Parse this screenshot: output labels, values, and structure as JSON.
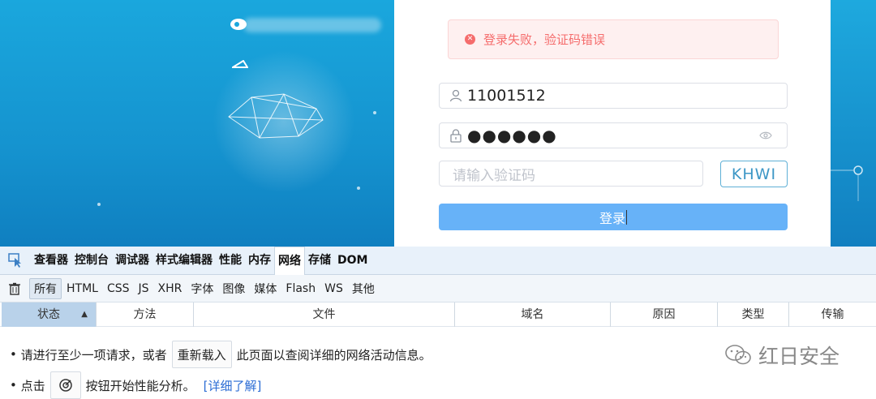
{
  "login": {
    "error_message": "登录失败，验证码错误",
    "username_value": "11001512",
    "password_mask": "●●●●●●",
    "captcha_placeholder": "请输入验证码",
    "captcha_code": "KHWI",
    "login_label": "登录"
  },
  "devtools": {
    "tabs": [
      "查看器",
      "控制台",
      "调试器",
      "样式编辑器",
      "性能",
      "内存",
      "网络",
      "存储",
      "DOM"
    ],
    "active_tab": "网络",
    "filters": [
      "所有",
      "HTML",
      "CSS",
      "JS",
      "XHR",
      "字体",
      "图像",
      "媒体",
      "Flash",
      "WS",
      "其他"
    ],
    "columns": [
      "状态",
      "方法",
      "文件",
      "域名",
      "原因",
      "类型",
      "传输"
    ],
    "sort_arrow": "▲",
    "message": {
      "line1_prefix": "请进行至少一项请求，或者",
      "reload_label": "重新载入",
      "line1_suffix": "此页面以查阅详细的网络活动信息。",
      "line2_prefix": "点击",
      "line2_suffix": "按钮开始性能分析。",
      "learn_more": "[详细了解]"
    }
  },
  "watermark": "红日安全",
  "colors": {
    "error": "#f56c6c",
    "login_button": "#67b2f8",
    "page_background": "#1aa7dd"
  }
}
